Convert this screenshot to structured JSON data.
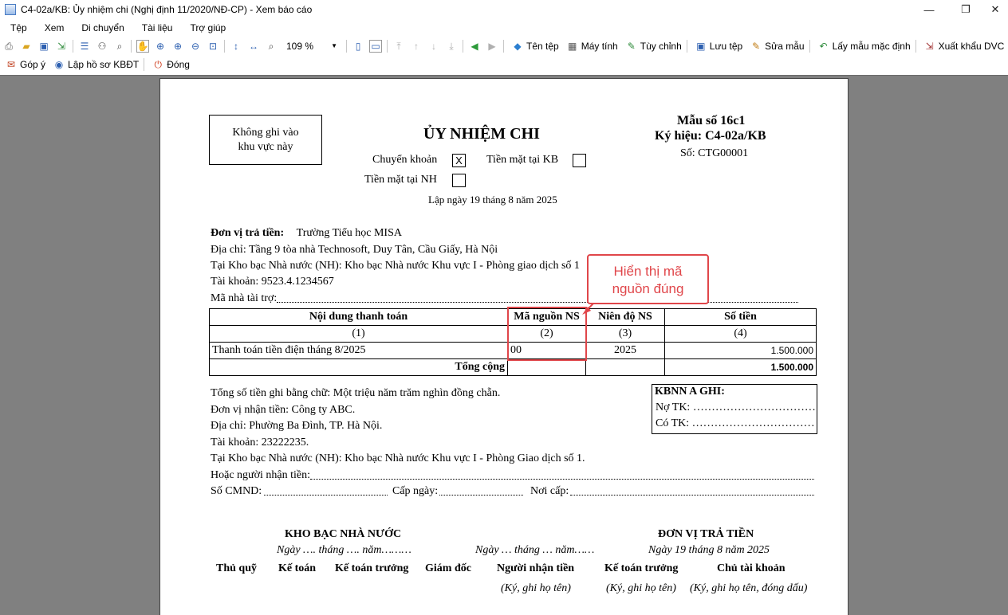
{
  "window": {
    "title": "C4-02a/KB: Ủy nhiệm chi (Nghị định 11/2020/NĐ-CP) - Xem báo cáo",
    "minimize": "—",
    "maximize": "❐",
    "close": "✕"
  },
  "menu": [
    "Tệp",
    "Xem",
    "Di chuyển",
    "Tài liệu",
    "Trợ giúp"
  ],
  "toolbar": {
    "zoom": "109 %",
    "buttons": {
      "file_name": "Tên tệp",
      "computer": "Máy tính",
      "customize": "Tùy chỉnh",
      "save_file": "Lưu tệp",
      "edit_template": "Sửa mẫu",
      "default_template": "Lấy mẫu mặc định",
      "export_dvc": "Xuất khẩu DVC"
    },
    "row2": {
      "feedback": "Góp ý",
      "create_kbdt": "Lập hồ sơ KBĐT",
      "close": "Đóng"
    }
  },
  "doc": {
    "stamp_box": "Không ghi vào\nkhu vực này",
    "title": "ỦY NHIỆM CHI",
    "form_no": "Mẫu số 16c1",
    "symbol": "Ký hiệu: C4-02a/KB",
    "number": "Số: CTG00001",
    "transfer_label": "Chuyển khoản",
    "transfer_mark": "X",
    "cash_kb_label": "Tiền mặt tại KB",
    "cash_nh_label": "Tiền mặt tại NH",
    "date_line": "Lập ngày 19 tháng 8 năm 2025",
    "payer_label": "Đơn vị trả tiền:",
    "payer_value": "Trường Tiểu học MISA",
    "address_line": "Địa chỉ: Tầng 9 tòa nhà Technosoft, Duy Tân, Cầu Giấy, Hà Nội",
    "treasury_line": "Tại Kho bạc Nhà nước (NH): Kho bạc Nhà nước Khu vực I - Phòng giao dịch số 1",
    "account_line": "Tài khoản: 9523.4.1234567",
    "sponsor_label": "Mã nhà tài trợ:",
    "table": {
      "headers": [
        "Nội dung thanh toán",
        "Mã nguồn NS",
        "Niên độ NS",
        "Số tiền"
      ],
      "col_nums": [
        "(1)",
        "(2)",
        "(3)",
        "(4)"
      ],
      "row": [
        "Thanh toán tiền điện tháng 8/2025",
        "00",
        "2025",
        "1.500.000"
      ],
      "total_label": "Tổng cộng",
      "total_value": "1.500.000"
    },
    "amount_words": "Tổng số tiền ghi bằng chữ: Một triệu năm trăm nghìn đồng chẵn.",
    "payee_line": "Đơn vị nhận tiền: Công ty ABC.",
    "payee_address": "Địa chỉ: Phường Ba Đình, TP. Hà Nội.",
    "payee_account": "Tài khoản: 23222235.",
    "payee_treasury": "Tại Kho bạc Nhà nước (NH): Kho bạc Nhà nước Khu vực I - Phòng Giao dịch số 1.",
    "or_receiver": "Hoặc người nhận tiền:",
    "id_label": "Số CMND:",
    "issue_date_label": "Cấp ngày:",
    "issue_place_label": "Nơi cấp:",
    "kbnn_box": {
      "title": "KBNN A GHI:",
      "debit": "Nợ TK: ……………………………",
      "credit": "Có TK: ……………………………"
    },
    "sign": {
      "treasury_title": "KHO BẠC NHÀ NƯỚC",
      "treasury_date": "Ngày …. tháng …. năm………",
      "receiver_date": "Ngày … tháng … năm……",
      "payer_title": "ĐƠN VỊ TRẢ TIỀN",
      "payer_date": "Ngày 19 tháng 8 năm 2025",
      "roles": [
        "Thủ quỹ",
        "Kế toán",
        "Kế toán trưởng",
        "Giám đốc",
        "Người nhận tiền",
        "Kế toán trưởng",
        "Chủ tài khoản"
      ],
      "notes": [
        "(Ký, ghi họ tên)",
        "(Ký, ghi họ tên)",
        "(Ký, ghi họ tên, đóng dấu)"
      ]
    }
  },
  "annotation": {
    "text": "Hiển thị mã\nnguồn đúng",
    "color": "#e0464a"
  }
}
